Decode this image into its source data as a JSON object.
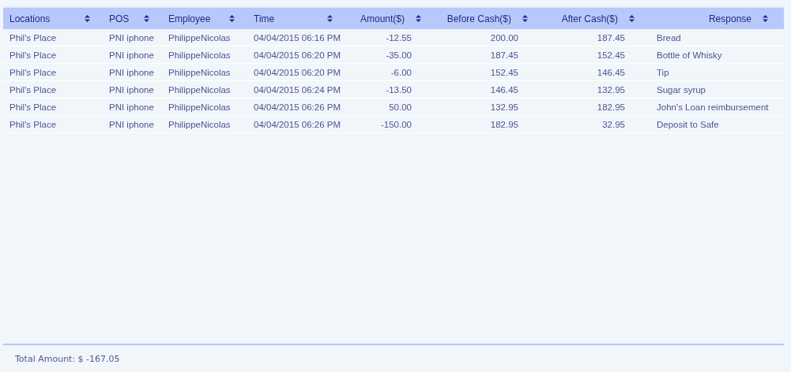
{
  "table": {
    "columns": [
      "Locations",
      "POS",
      "Employee",
      "Time",
      "Amount($)",
      "Before Cash($)",
      "After Cash($)",
      "Response"
    ],
    "rows": [
      [
        "Phil's Place",
        "PNI iphone",
        "PhilippeNicolas",
        "04/04/2015 06:16 PM",
        "-12.55",
        "200.00",
        "187.45",
        "Bread"
      ],
      [
        "Phil's Place",
        "PNI iphone",
        "PhilippeNicolas",
        "04/04/2015 06:20 PM",
        "-35.00",
        "187.45",
        "152.45",
        "Bottle of Whisky"
      ],
      [
        "Phil's Place",
        "PNI iphone",
        "PhilippeNicolas",
        "04/04/2015 06:20 PM",
        "-6.00",
        "152.45",
        "146.45",
        "Tip"
      ],
      [
        "Phil's Place",
        "PNI iphone",
        "PhilippeNicolas",
        "04/04/2015 06:24 PM",
        "-13.50",
        "146.45",
        "132.95",
        "Sugar syrup"
      ],
      [
        "Phil's Place",
        "PNI iphone",
        "PhilippeNicolas",
        "04/04/2015 06:26 PM",
        "50.00",
        "132.95",
        "182.95",
        "John's Loan reimbursement"
      ],
      [
        "Phil's Place",
        "PNI iphone",
        "PhilippeNicolas",
        "04/04/2015 06:26 PM",
        "-150.00",
        "182.95",
        "32.95",
        "Deposit to Safe"
      ]
    ]
  },
  "footer": {
    "total": "Total Amount: $ -167.05"
  }
}
